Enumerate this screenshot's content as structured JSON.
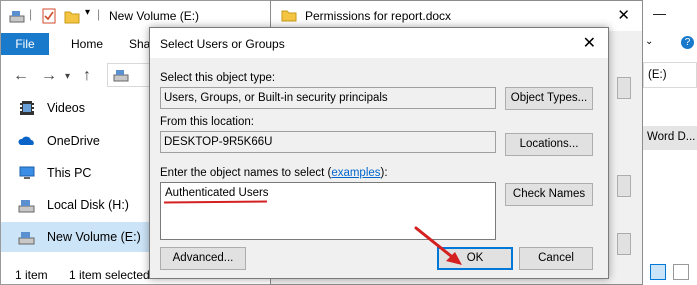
{
  "explorer": {
    "title": "New Volume (E:)",
    "tabs": [
      "File",
      "Home",
      "Sha"
    ],
    "sidebar": [
      {
        "label": "Videos",
        "icon": "video-folder-icon"
      },
      {
        "label": "OneDrive",
        "icon": "onedrive-icon"
      },
      {
        "label": "This PC",
        "icon": "computer-icon"
      },
      {
        "label": "Local Disk (H:)",
        "icon": "drive-icon"
      },
      {
        "label": "New Volume (E:)",
        "icon": "drive-icon"
      }
    ],
    "status": {
      "items": "1 item",
      "selected": "1 item selected"
    },
    "right_partial": {
      "drive": "(E:)",
      "filetype": "Word D..."
    }
  },
  "permissions": {
    "title": "Permissions for report.docx"
  },
  "dialog": {
    "title": "Select Users or Groups",
    "object_type_label": "Select this object type:",
    "object_type_value": "Users, Groups, or Built-in security principals",
    "object_types_button": "Object Types...",
    "location_label": "From this location:",
    "location_value": "DESKTOP-9R5K66U",
    "locations_button": "Locations...",
    "names_label_prefix": "Enter the object names to select (",
    "names_label_link": "examples",
    "names_label_suffix": "):",
    "names_value": "Authenticated Users",
    "check_names_button": "Check Names",
    "advanced_button": "Advanced...",
    "ok_button": "OK",
    "cancel_button": "Cancel"
  },
  "colors": {
    "accent": "#1979ca",
    "selection": "#cce4f7",
    "annotation": "#d42020"
  }
}
